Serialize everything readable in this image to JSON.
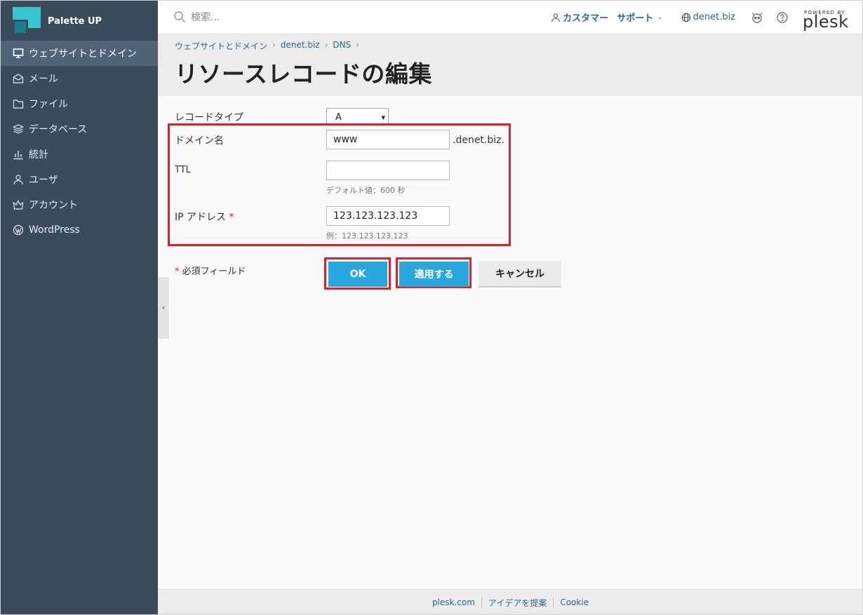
{
  "brand": {
    "name": "Palette UP"
  },
  "sidebar": {
    "items": [
      {
        "label": "ウェブサイトとドメイン",
        "icon": "monitor-icon",
        "active": true
      },
      {
        "label": "メール",
        "icon": "mail-icon"
      },
      {
        "label": "ファイル",
        "icon": "folder-icon"
      },
      {
        "label": "データベース",
        "icon": "database-icon"
      },
      {
        "label": "統計",
        "icon": "bar-chart-icon"
      },
      {
        "label": "ユーザ",
        "icon": "user-icon"
      },
      {
        "label": "アカウント",
        "icon": "crown-icon"
      },
      {
        "label": "WordPress",
        "icon": "wordpress-icon"
      }
    ]
  },
  "header": {
    "search_placeholder": "検索...",
    "customer": "カスタマー",
    "support": "サポート",
    "domain": "denet.biz",
    "powered_by": "POWERED BY",
    "plesk": "plesk"
  },
  "breadcrumb": [
    "ウェブサイトとドメイン",
    "denet.biz",
    "DNS"
  ],
  "page_title": "リソースレコードの編集",
  "form": {
    "record_type_label": "レコードタイプ",
    "record_type_value": "A",
    "domain_label": "ドメイン名",
    "domain_value": "www",
    "domain_suffix": ".denet.biz.",
    "ttl_label": "TTL",
    "ttl_value": "",
    "ttl_hint": "デフォルト値：600 秒",
    "ip_label": "IP アドレス",
    "ip_required_mark": "*",
    "ip_value": "123.123.123.123",
    "ip_hint": "例：123.123.123.123",
    "required_mark": "*",
    "required_note": "必須フィールド"
  },
  "buttons": {
    "ok": "OK",
    "apply": "適用する",
    "cancel": "キャンセル"
  },
  "footer": {
    "links": [
      "plesk.com",
      "アイデアを提案",
      "Cookie"
    ]
  },
  "colors": {
    "sidebar": "#3a4b5c",
    "accent": "#29a8df",
    "link": "#28698a",
    "highlight": "#e01e2d"
  }
}
